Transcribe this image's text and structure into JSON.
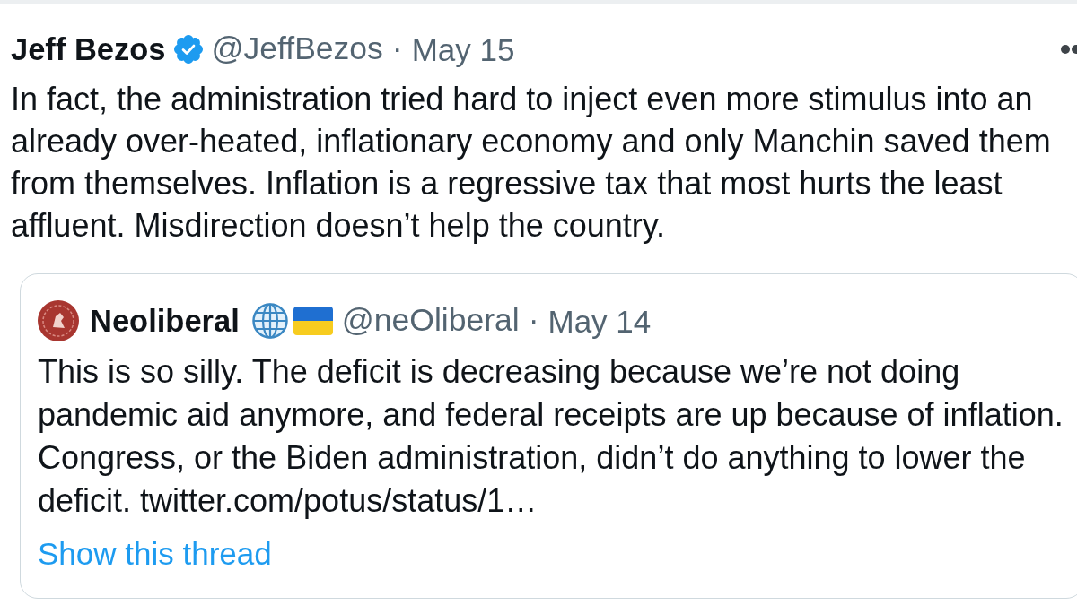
{
  "tweet": {
    "author": {
      "name": "Jeff Bezos",
      "verified": true,
      "handle": "@JeffBezos",
      "separator": "·",
      "date": "May 15"
    },
    "text": "In fact, the administration tried hard to inject even more stimulus into an already over-heated, inflationary economy and only Manchin saved them from themselves. Inflation is a regressive tax that most hurts the least affluent. Misdirection doesn’t help the country.",
    "quoted_tweet": {
      "author": {
        "name": "Neoliberal",
        "handle": "@neOliberal",
        "separator": "·",
        "date": "May 14"
      },
      "text": "This is so silly. The deficit is decreasing because we’re not doing pandemic aid anymore, and federal receipts are up because of inflation. Congress, or the Biden administration, didn’t do anything to lower the deficit. twitter.com/potus/status/1…",
      "link": "Show this thread"
    }
  }
}
